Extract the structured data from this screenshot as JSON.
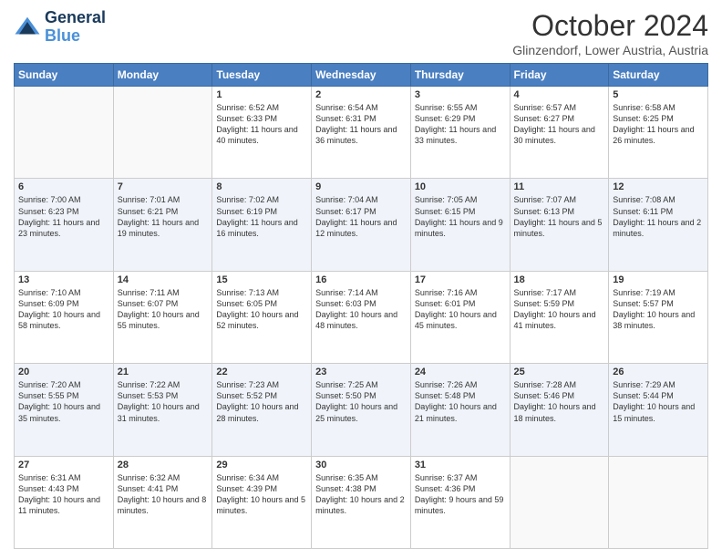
{
  "header": {
    "logo_line1": "General",
    "logo_line2": "Blue",
    "title": "October 2024",
    "subtitle": "Glinzendorf, Lower Austria, Austria"
  },
  "days_of_week": [
    "Sunday",
    "Monday",
    "Tuesday",
    "Wednesday",
    "Thursday",
    "Friday",
    "Saturday"
  ],
  "weeks": [
    [
      {
        "day": "",
        "info": ""
      },
      {
        "day": "",
        "info": ""
      },
      {
        "day": "1",
        "info": "Sunrise: 6:52 AM\nSunset: 6:33 PM\nDaylight: 11 hours and 40 minutes."
      },
      {
        "day": "2",
        "info": "Sunrise: 6:54 AM\nSunset: 6:31 PM\nDaylight: 11 hours and 36 minutes."
      },
      {
        "day": "3",
        "info": "Sunrise: 6:55 AM\nSunset: 6:29 PM\nDaylight: 11 hours and 33 minutes."
      },
      {
        "day": "4",
        "info": "Sunrise: 6:57 AM\nSunset: 6:27 PM\nDaylight: 11 hours and 30 minutes."
      },
      {
        "day": "5",
        "info": "Sunrise: 6:58 AM\nSunset: 6:25 PM\nDaylight: 11 hours and 26 minutes."
      }
    ],
    [
      {
        "day": "6",
        "info": "Sunrise: 7:00 AM\nSunset: 6:23 PM\nDaylight: 11 hours and 23 minutes."
      },
      {
        "day": "7",
        "info": "Sunrise: 7:01 AM\nSunset: 6:21 PM\nDaylight: 11 hours and 19 minutes."
      },
      {
        "day": "8",
        "info": "Sunrise: 7:02 AM\nSunset: 6:19 PM\nDaylight: 11 hours and 16 minutes."
      },
      {
        "day": "9",
        "info": "Sunrise: 7:04 AM\nSunset: 6:17 PM\nDaylight: 11 hours and 12 minutes."
      },
      {
        "day": "10",
        "info": "Sunrise: 7:05 AM\nSunset: 6:15 PM\nDaylight: 11 hours and 9 minutes."
      },
      {
        "day": "11",
        "info": "Sunrise: 7:07 AM\nSunset: 6:13 PM\nDaylight: 11 hours and 5 minutes."
      },
      {
        "day": "12",
        "info": "Sunrise: 7:08 AM\nSunset: 6:11 PM\nDaylight: 11 hours and 2 minutes."
      }
    ],
    [
      {
        "day": "13",
        "info": "Sunrise: 7:10 AM\nSunset: 6:09 PM\nDaylight: 10 hours and 58 minutes."
      },
      {
        "day": "14",
        "info": "Sunrise: 7:11 AM\nSunset: 6:07 PM\nDaylight: 10 hours and 55 minutes."
      },
      {
        "day": "15",
        "info": "Sunrise: 7:13 AM\nSunset: 6:05 PM\nDaylight: 10 hours and 52 minutes."
      },
      {
        "day": "16",
        "info": "Sunrise: 7:14 AM\nSunset: 6:03 PM\nDaylight: 10 hours and 48 minutes."
      },
      {
        "day": "17",
        "info": "Sunrise: 7:16 AM\nSunset: 6:01 PM\nDaylight: 10 hours and 45 minutes."
      },
      {
        "day": "18",
        "info": "Sunrise: 7:17 AM\nSunset: 5:59 PM\nDaylight: 10 hours and 41 minutes."
      },
      {
        "day": "19",
        "info": "Sunrise: 7:19 AM\nSunset: 5:57 PM\nDaylight: 10 hours and 38 minutes."
      }
    ],
    [
      {
        "day": "20",
        "info": "Sunrise: 7:20 AM\nSunset: 5:55 PM\nDaylight: 10 hours and 35 minutes."
      },
      {
        "day": "21",
        "info": "Sunrise: 7:22 AM\nSunset: 5:53 PM\nDaylight: 10 hours and 31 minutes."
      },
      {
        "day": "22",
        "info": "Sunrise: 7:23 AM\nSunset: 5:52 PM\nDaylight: 10 hours and 28 minutes."
      },
      {
        "day": "23",
        "info": "Sunrise: 7:25 AM\nSunset: 5:50 PM\nDaylight: 10 hours and 25 minutes."
      },
      {
        "day": "24",
        "info": "Sunrise: 7:26 AM\nSunset: 5:48 PM\nDaylight: 10 hours and 21 minutes."
      },
      {
        "day": "25",
        "info": "Sunrise: 7:28 AM\nSunset: 5:46 PM\nDaylight: 10 hours and 18 minutes."
      },
      {
        "day": "26",
        "info": "Sunrise: 7:29 AM\nSunset: 5:44 PM\nDaylight: 10 hours and 15 minutes."
      }
    ],
    [
      {
        "day": "27",
        "info": "Sunrise: 6:31 AM\nSunset: 4:43 PM\nDaylight: 10 hours and 11 minutes."
      },
      {
        "day": "28",
        "info": "Sunrise: 6:32 AM\nSunset: 4:41 PM\nDaylight: 10 hours and 8 minutes."
      },
      {
        "day": "29",
        "info": "Sunrise: 6:34 AM\nSunset: 4:39 PM\nDaylight: 10 hours and 5 minutes."
      },
      {
        "day": "30",
        "info": "Sunrise: 6:35 AM\nSunset: 4:38 PM\nDaylight: 10 hours and 2 minutes."
      },
      {
        "day": "31",
        "info": "Sunrise: 6:37 AM\nSunset: 4:36 PM\nDaylight: 9 hours and 59 minutes."
      },
      {
        "day": "",
        "info": ""
      },
      {
        "day": "",
        "info": ""
      }
    ]
  ]
}
